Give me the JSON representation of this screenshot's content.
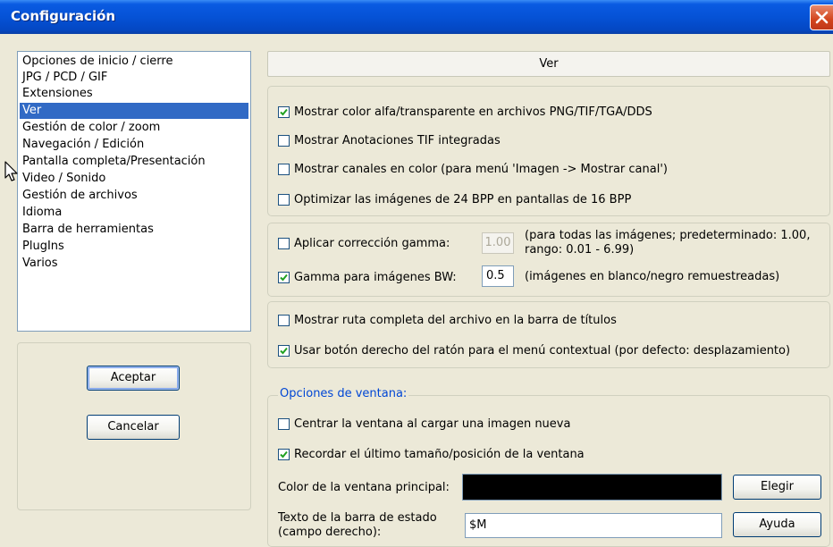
{
  "window": {
    "title": "Configuración",
    "close_icon": "close-icon"
  },
  "categories": [
    {
      "label": "Opciones de inicio / cierre",
      "selected": false
    },
    {
      "label": "JPG / PCD / GIF",
      "selected": false
    },
    {
      "label": "Extensiones",
      "selected": false
    },
    {
      "label": "Ver",
      "selected": true
    },
    {
      "label": "Gestión de color / zoom",
      "selected": false
    },
    {
      "label": "Navegación / Edición",
      "selected": false
    },
    {
      "label": "Pantalla completa/Presentación",
      "selected": false
    },
    {
      "label": "Video / Sonido",
      "selected": false
    },
    {
      "label": "Gestión de archivos",
      "selected": false
    },
    {
      "label": "Idioma",
      "selected": false
    },
    {
      "label": "Barra de herramientas",
      "selected": false
    },
    {
      "label": "PlugIns",
      "selected": false
    },
    {
      "label": "Varios",
      "selected": false
    }
  ],
  "buttons": {
    "accept": "Aceptar",
    "cancel": "Cancelar",
    "choose": "Elegir",
    "help": "Ayuda"
  },
  "section_header": "Ver",
  "display_options": [
    {
      "label": "Mostrar color alfa/transparente en archivos PNG/TIF/TGA/DDS",
      "checked": true
    },
    {
      "label": "Mostrar Anotaciones TIF integradas",
      "checked": false
    },
    {
      "label": "Mostrar canales en color (para menú 'Imagen -> Mostrar canal')",
      "checked": false
    },
    {
      "label": "Optimizar las imágenes de 24 BPP en pantallas de 16 BPP",
      "checked": false
    }
  ],
  "gamma": {
    "apply_label": "Aplicar corrección gamma:",
    "apply_checked": false,
    "apply_value": "1.00",
    "apply_note_line1": "(para todas las imágenes; predeterminado: 1.00,",
    "apply_note_line2": "rango: 0.01 - 6.99)",
    "bw_label": "Gamma para imágenes BW:",
    "bw_checked": true,
    "bw_value": "0.5",
    "bw_note": "(imágenes en blanco/negro remuestreadas)"
  },
  "misc_options": [
    {
      "label": "Mostrar ruta completa del archivo en la barra de títulos",
      "checked": false
    },
    {
      "label": "Usar botón derecho del ratón para el menú contextual (por defecto: desplazamiento)",
      "checked": true
    }
  ],
  "window_options": {
    "title": "Opciones de ventana:",
    "center": {
      "label": "Centrar la ventana al cargar una imagen nueva",
      "checked": false
    },
    "remember": {
      "label": "Recordar el último tamaño/posición de la ventana",
      "checked": true
    },
    "main_color_label": "Color de la ventana principal:",
    "main_color": "#000000",
    "status_text_label_line1": "Texto de la barra de estado",
    "status_text_label_line2": "(campo derecho):",
    "status_text_value": "$M"
  },
  "colors": {
    "titlebar": "#0552d6",
    "selection": "#316ac5",
    "accent_text": "#0046d5",
    "checkmark": "#21a121"
  }
}
